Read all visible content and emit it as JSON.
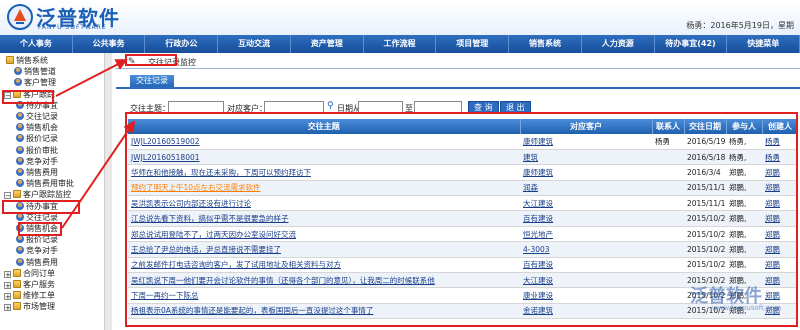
{
  "header": {
    "logo_text": "泛普软件",
    "logo_sub": "FANPU SOFTWARE",
    "user_info": "杨勇：2016年5月19日，星期"
  },
  "nav": [
    "个人事务",
    "公共事务",
    "行政办公",
    "互动交流",
    "资产管理",
    "工作流程",
    "项目管理",
    "销售系统",
    "人力资源",
    "待办事宜(42)",
    "快捷菜单"
  ],
  "sidebar": {
    "items": [
      {
        "label": "销售系统",
        "icon": "folder-icon"
      },
      {
        "label": "销售管道",
        "icon": "user-icon"
      },
      {
        "label": "客户管理",
        "icon": "user-icon"
      },
      {
        "label": "客户跟踪",
        "icon": "folder-icon"
      },
      {
        "label": "待办事宜",
        "icon": "user-icon"
      },
      {
        "label": "交往记录",
        "icon": "user-icon"
      },
      {
        "label": "销售机会",
        "icon": "user-icon"
      },
      {
        "label": "报价记录",
        "icon": "user-icon"
      },
      {
        "label": "报价审批",
        "icon": "user-icon"
      },
      {
        "label": "竞争对手",
        "icon": "user-icon"
      },
      {
        "label": "销售费用",
        "icon": "user-icon"
      },
      {
        "label": "销售费用审批",
        "icon": "user-icon"
      },
      {
        "label": "客户跟踪监控",
        "icon": "folder-icon"
      },
      {
        "label": "待办事宜",
        "icon": "user-icon"
      },
      {
        "label": "交往记录",
        "icon": "user-icon"
      },
      {
        "label": "销售机会",
        "icon": "user-icon"
      },
      {
        "label": "报价记录",
        "icon": "user-icon"
      },
      {
        "label": "竞争对手",
        "icon": "user-icon"
      },
      {
        "label": "销售费用",
        "icon": "user-icon"
      },
      {
        "label": "合同订单",
        "icon": "folder-icon"
      },
      {
        "label": "客户服务",
        "icon": "folder-icon"
      },
      {
        "label": "维修工单",
        "icon": "folder-icon"
      },
      {
        "label": "市场管理",
        "icon": "folder-icon"
      }
    ]
  },
  "content": {
    "page_title": "交往记录监控",
    "tab_label": "交往记录",
    "search": {
      "subject_label": "交往主题：",
      "customer_label": "对应客户：",
      "date_from_label": "日期从",
      "date_to_label": "至",
      "query_button": "查 询",
      "exit_button": "退 出"
    },
    "table": {
      "headers": [
        "交往主题",
        "对应客户",
        "联系人",
        "交往日期",
        "参与人",
        "创建人"
      ],
      "rows": [
        {
          "subject": "JWJL20160519002",
          "customer": "康师建筑",
          "contact": "杨勇",
          "date": "2016/5/19",
          "participant": "杨勇,",
          "creator": "杨勇",
          "orange": false
        },
        {
          "subject": "JWJL20160518001",
          "customer": "建筑",
          "contact": "",
          "date": "2016/5/18",
          "participant": "杨勇,",
          "creator": "杨勇",
          "orange": false
        },
        {
          "subject": "华师在和他接触，现在还未采购，下周可以预约拜访下",
          "customer": "康师建筑",
          "contact": "",
          "date": "2016/3/4",
          "participant": "郑鹏,",
          "creator": "郑鹏",
          "orange": false
        },
        {
          "subject": "预约了明天上午10点左右交流需求软件",
          "customer": "润森",
          "contact": "",
          "date": "2015/11/18",
          "participant": "郑鹏,",
          "creator": "郑鹏",
          "orange": true
        },
        {
          "subject": "吴洪凯表示公司内部还没有进行讨论",
          "customer": "大江建设",
          "contact": "",
          "date": "2015/11/13",
          "participant": "郑鹏,",
          "creator": "郑鹏",
          "orange": false
        },
        {
          "subject": "江总说先看下资料，搞似乎需不是很要急的样子",
          "customer": "百有建设",
          "contact": "",
          "date": "2015/10/27",
          "participant": "郑鹏,",
          "creator": "郑鹏",
          "orange": false
        },
        {
          "subject": "郑总说试用登陆不了，过两天因办公室设问好交流",
          "customer": "恒光地产",
          "contact": "",
          "date": "2015/10/27",
          "participant": "郑鹏,",
          "creator": "郑鹏",
          "orange": false
        },
        {
          "subject": "王总给了尹总的电话，尹总直接说不需要挂了",
          "customer": "4-3003",
          "contact": "",
          "date": "2015/10/26",
          "participant": "郑鹏,",
          "creator": "郑鹏",
          "orange": false
        },
        {
          "subject": "之前发邮件打电话咨询的客户，发了试用地址及相关资料与对方",
          "customer": "百有建设",
          "contact": "",
          "date": "2015/10/26",
          "participant": "郑鹏,",
          "creator": "郑鹏",
          "orange": false
        },
        {
          "subject": "吴红凯说下周一他们要开会讨论软件的事情（还得各个部门的意见），让我周二的时候联系他",
          "customer": "大江建设",
          "contact": "",
          "date": "2015/10/23",
          "participant": "郑鹏,",
          "creator": "郑鹏",
          "orange": false
        },
        {
          "subject": "下周一再约一下陈总",
          "customer": "康业建设",
          "contact": "",
          "date": "2015/10/23",
          "participant": "郑鹏,",
          "creator": "郑鹏",
          "orange": false
        },
        {
          "subject": "杨祖表示0A系统的事情还是能要起的，表板国国后一直没提过这个事情了",
          "customer": "金诺建筑",
          "contact": "",
          "date": "2015/10/21",
          "participant": "郑鹏,",
          "creator": "郑鹏",
          "orange": false
        }
      ]
    }
  },
  "watermark": {
    "text": "泛普软件",
    "url": "www.fanpusoft.com"
  },
  "colors": {
    "nav_blue": "#1f5fae",
    "highlight_red": "#e02020",
    "link_orange": "#ff7d00"
  }
}
